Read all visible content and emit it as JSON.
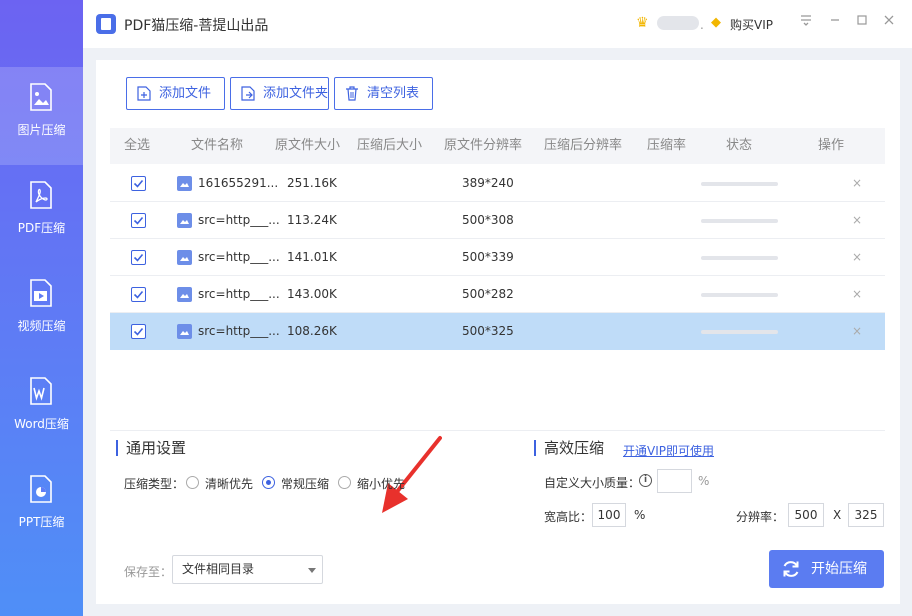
{
  "app": {
    "title": "PDF猫压缩-菩提山出品",
    "buy_vip": "购买VIP",
    "username_suffix": "."
  },
  "sidebar": {
    "items": [
      {
        "label": "图片压缩",
        "icon": "image-file-icon",
        "active": true
      },
      {
        "label": "PDF压缩",
        "icon": "pdf-file-icon",
        "active": false
      },
      {
        "label": "视频压缩",
        "icon": "video-file-icon",
        "active": false
      },
      {
        "label": "Word压缩",
        "icon": "word-file-icon",
        "active": false
      },
      {
        "label": "PPT压缩",
        "icon": "ppt-file-icon",
        "active": false
      }
    ]
  },
  "toolbar": {
    "add_file": "添加文件",
    "add_folder": "添加文件夹",
    "clear_list": "清空列表"
  },
  "table": {
    "columns": [
      "全选",
      "文件名称",
      "原文件大小",
      "压缩后大小",
      "原文件分辨率",
      "压缩后分辨率",
      "压缩率",
      "状态",
      "操作"
    ],
    "rows": [
      {
        "name": "161655291...",
        "size": "251.16K",
        "resolution": "389*240",
        "remove": "×",
        "checked": true,
        "selected": false
      },
      {
        "name": "src=http___...",
        "size": "113.24K",
        "resolution": "500*308",
        "remove": "×",
        "checked": true,
        "selected": false
      },
      {
        "name": "src=http___...",
        "size": "141.01K",
        "resolution": "500*339",
        "remove": "×",
        "checked": true,
        "selected": false
      },
      {
        "name": "src=http___...",
        "size": "143.00K",
        "resolution": "500*282",
        "remove": "×",
        "checked": true,
        "selected": false
      },
      {
        "name": "src=http___...",
        "size": "108.26K",
        "resolution": "500*325",
        "remove": "×",
        "checked": true,
        "selected": true
      }
    ]
  },
  "general_settings": {
    "title": "通用设置",
    "compress_type_label": "压缩类型：",
    "options": [
      "清晰优先",
      "常规压缩",
      "缩小优先"
    ],
    "selected_option": "常规压缩"
  },
  "efficient": {
    "title": "高效压缩",
    "vip_link": "开通VIP即可使用",
    "custom_size_label": "自定义大小质量：",
    "custom_size_value": "",
    "percent_sign": "%",
    "aspect_label": "宽高比：",
    "aspect_value": "100",
    "aspect_unit": "%",
    "resolution_label": "分辨率：",
    "res_width": "500",
    "res_separator": "X",
    "res_height": "325"
  },
  "footer": {
    "save_to_label": "保存至：",
    "save_to_value": "文件相同目录",
    "start_button": "开始压缩"
  },
  "colors": {
    "accent": "#3d62e0",
    "selected_row": "#bfdcf8",
    "start_button": "#5b7cf1",
    "arrow": "#e8312c"
  }
}
